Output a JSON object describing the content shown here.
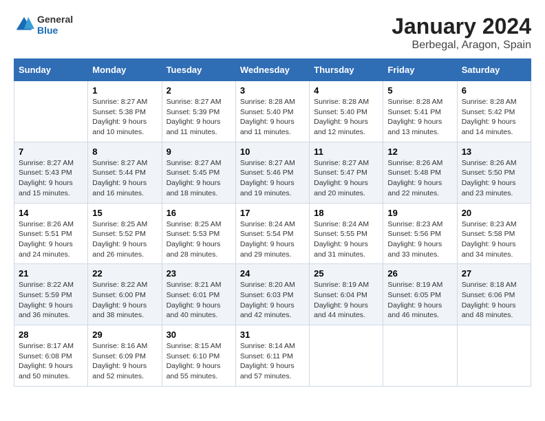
{
  "header": {
    "logo_general": "General",
    "logo_blue": "Blue",
    "title": "January 2024",
    "subtitle": "Berbegal, Aragon, Spain"
  },
  "days_of_week": [
    "Sunday",
    "Monday",
    "Tuesday",
    "Wednesday",
    "Thursday",
    "Friday",
    "Saturday"
  ],
  "weeks": [
    [
      {
        "day": "",
        "info": ""
      },
      {
        "day": "1",
        "info": "Sunrise: 8:27 AM\nSunset: 5:38 PM\nDaylight: 9 hours\nand 10 minutes."
      },
      {
        "day": "2",
        "info": "Sunrise: 8:27 AM\nSunset: 5:39 PM\nDaylight: 9 hours\nand 11 minutes."
      },
      {
        "day": "3",
        "info": "Sunrise: 8:28 AM\nSunset: 5:40 PM\nDaylight: 9 hours\nand 11 minutes."
      },
      {
        "day": "4",
        "info": "Sunrise: 8:28 AM\nSunset: 5:40 PM\nDaylight: 9 hours\nand 12 minutes."
      },
      {
        "day": "5",
        "info": "Sunrise: 8:28 AM\nSunset: 5:41 PM\nDaylight: 9 hours\nand 13 minutes."
      },
      {
        "day": "6",
        "info": "Sunrise: 8:28 AM\nSunset: 5:42 PM\nDaylight: 9 hours\nand 14 minutes."
      }
    ],
    [
      {
        "day": "7",
        "info": "Sunrise: 8:27 AM\nSunset: 5:43 PM\nDaylight: 9 hours\nand 15 minutes."
      },
      {
        "day": "8",
        "info": "Sunrise: 8:27 AM\nSunset: 5:44 PM\nDaylight: 9 hours\nand 16 minutes."
      },
      {
        "day": "9",
        "info": "Sunrise: 8:27 AM\nSunset: 5:45 PM\nDaylight: 9 hours\nand 18 minutes."
      },
      {
        "day": "10",
        "info": "Sunrise: 8:27 AM\nSunset: 5:46 PM\nDaylight: 9 hours\nand 19 minutes."
      },
      {
        "day": "11",
        "info": "Sunrise: 8:27 AM\nSunset: 5:47 PM\nDaylight: 9 hours\nand 20 minutes."
      },
      {
        "day": "12",
        "info": "Sunrise: 8:26 AM\nSunset: 5:48 PM\nDaylight: 9 hours\nand 22 minutes."
      },
      {
        "day": "13",
        "info": "Sunrise: 8:26 AM\nSunset: 5:50 PM\nDaylight: 9 hours\nand 23 minutes."
      }
    ],
    [
      {
        "day": "14",
        "info": "Sunrise: 8:26 AM\nSunset: 5:51 PM\nDaylight: 9 hours\nand 24 minutes."
      },
      {
        "day": "15",
        "info": "Sunrise: 8:25 AM\nSunset: 5:52 PM\nDaylight: 9 hours\nand 26 minutes."
      },
      {
        "day": "16",
        "info": "Sunrise: 8:25 AM\nSunset: 5:53 PM\nDaylight: 9 hours\nand 28 minutes."
      },
      {
        "day": "17",
        "info": "Sunrise: 8:24 AM\nSunset: 5:54 PM\nDaylight: 9 hours\nand 29 minutes."
      },
      {
        "day": "18",
        "info": "Sunrise: 8:24 AM\nSunset: 5:55 PM\nDaylight: 9 hours\nand 31 minutes."
      },
      {
        "day": "19",
        "info": "Sunrise: 8:23 AM\nSunset: 5:56 PM\nDaylight: 9 hours\nand 33 minutes."
      },
      {
        "day": "20",
        "info": "Sunrise: 8:23 AM\nSunset: 5:58 PM\nDaylight: 9 hours\nand 34 minutes."
      }
    ],
    [
      {
        "day": "21",
        "info": "Sunrise: 8:22 AM\nSunset: 5:59 PM\nDaylight: 9 hours\nand 36 minutes."
      },
      {
        "day": "22",
        "info": "Sunrise: 8:22 AM\nSunset: 6:00 PM\nDaylight: 9 hours\nand 38 minutes."
      },
      {
        "day": "23",
        "info": "Sunrise: 8:21 AM\nSunset: 6:01 PM\nDaylight: 9 hours\nand 40 minutes."
      },
      {
        "day": "24",
        "info": "Sunrise: 8:20 AM\nSunset: 6:03 PM\nDaylight: 9 hours\nand 42 minutes."
      },
      {
        "day": "25",
        "info": "Sunrise: 8:19 AM\nSunset: 6:04 PM\nDaylight: 9 hours\nand 44 minutes."
      },
      {
        "day": "26",
        "info": "Sunrise: 8:19 AM\nSunset: 6:05 PM\nDaylight: 9 hours\nand 46 minutes."
      },
      {
        "day": "27",
        "info": "Sunrise: 8:18 AM\nSunset: 6:06 PM\nDaylight: 9 hours\nand 48 minutes."
      }
    ],
    [
      {
        "day": "28",
        "info": "Sunrise: 8:17 AM\nSunset: 6:08 PM\nDaylight: 9 hours\nand 50 minutes."
      },
      {
        "day": "29",
        "info": "Sunrise: 8:16 AM\nSunset: 6:09 PM\nDaylight: 9 hours\nand 52 minutes."
      },
      {
        "day": "30",
        "info": "Sunrise: 8:15 AM\nSunset: 6:10 PM\nDaylight: 9 hours\nand 55 minutes."
      },
      {
        "day": "31",
        "info": "Sunrise: 8:14 AM\nSunset: 6:11 PM\nDaylight: 9 hours\nand 57 minutes."
      },
      {
        "day": "",
        "info": ""
      },
      {
        "day": "",
        "info": ""
      },
      {
        "day": "",
        "info": ""
      }
    ]
  ]
}
